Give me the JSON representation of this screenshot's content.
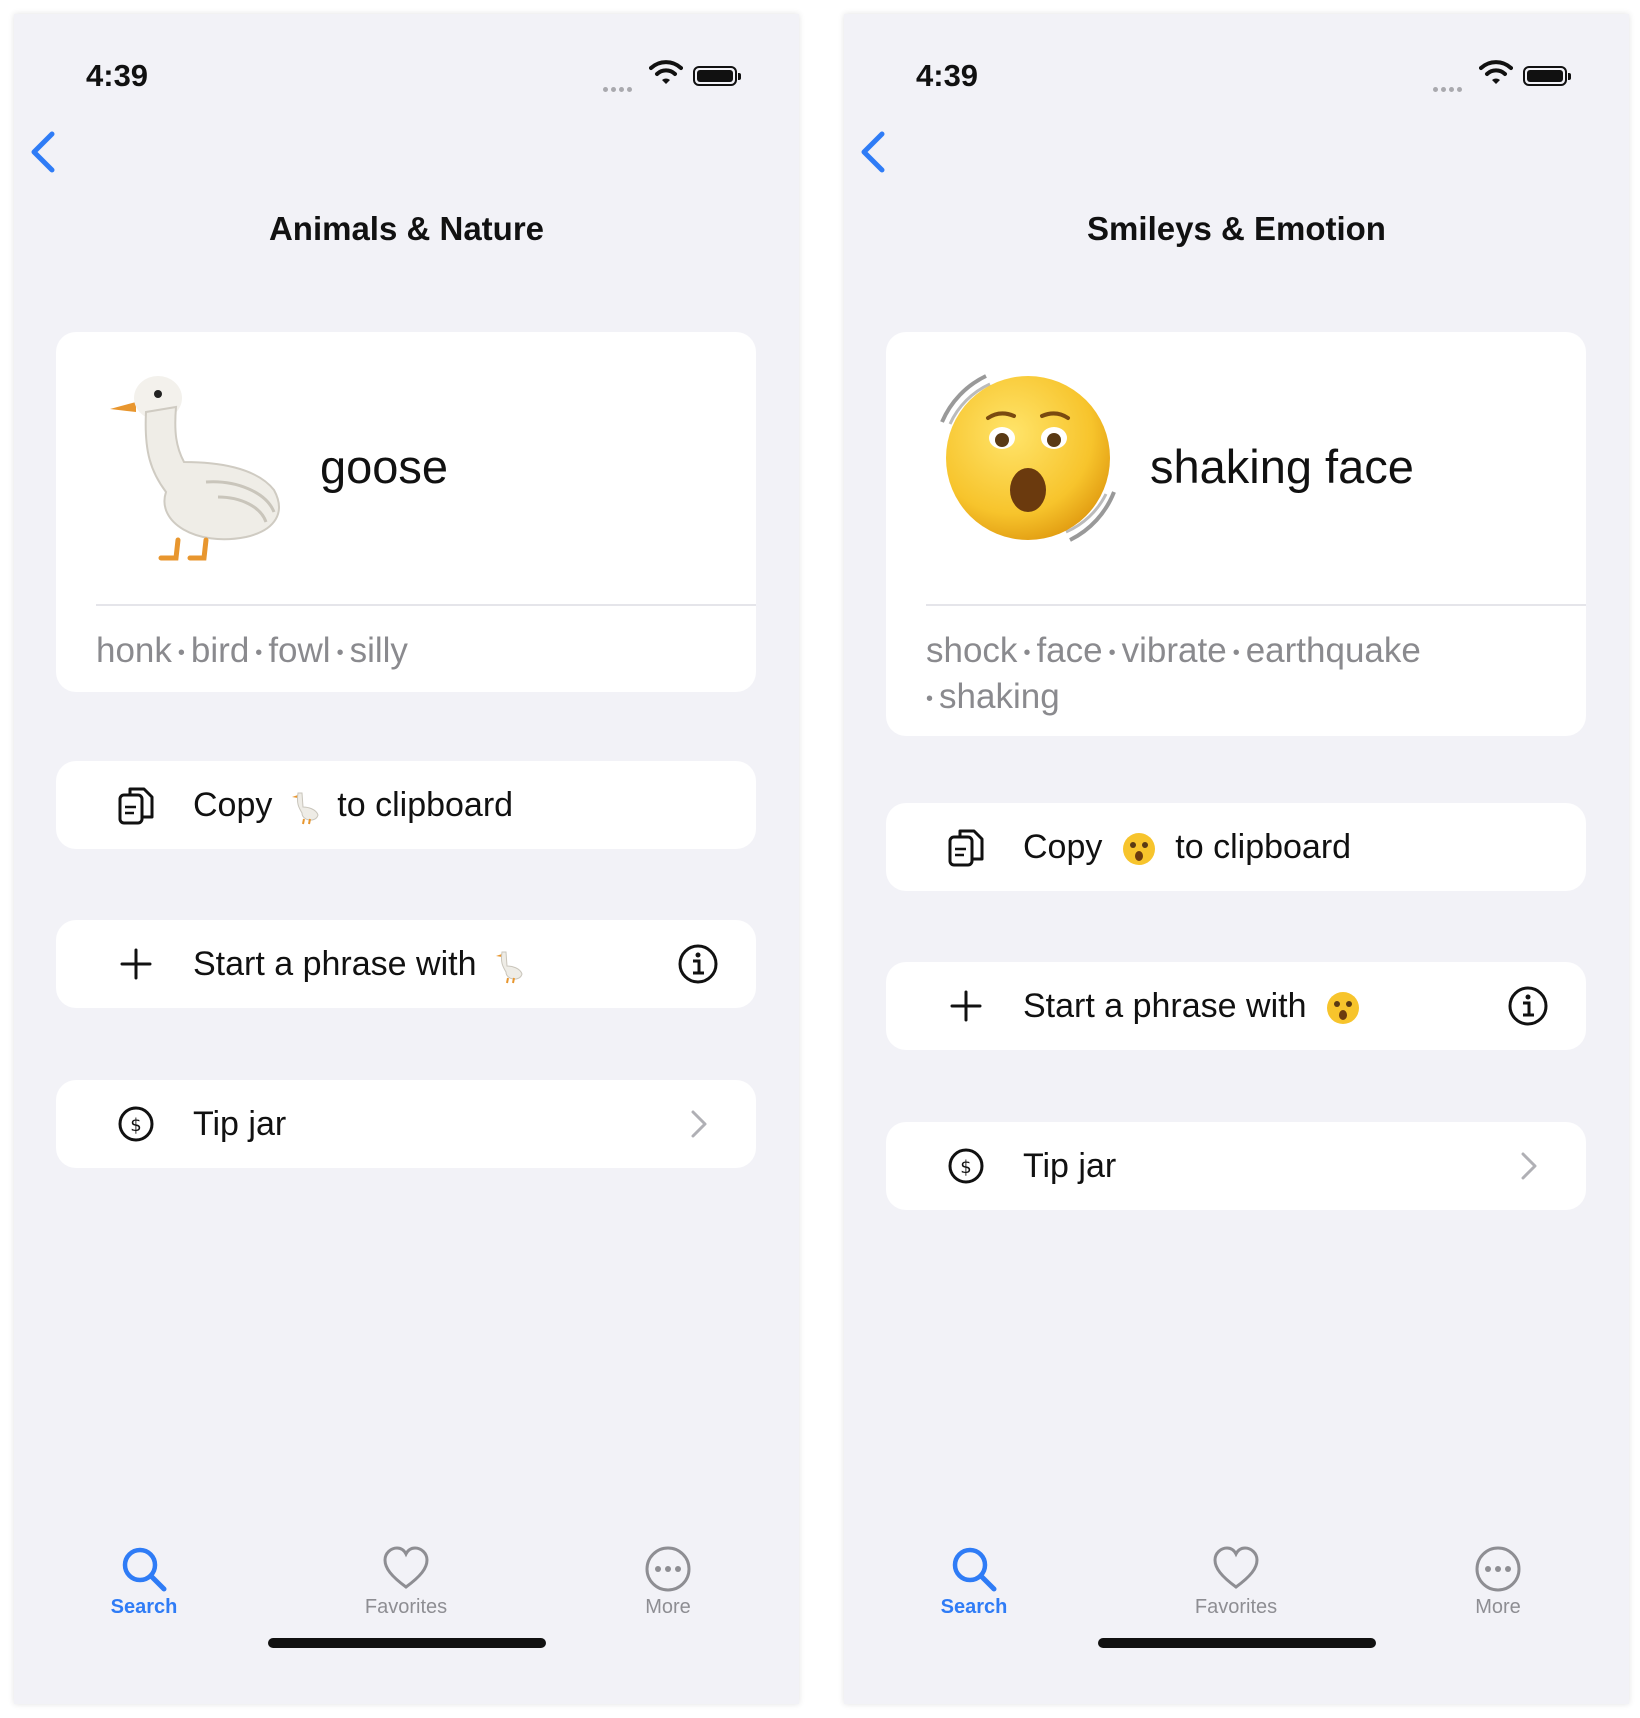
{
  "accent_color": "#2f7cf6",
  "screens": [
    {
      "status_time": "4:39",
      "nav_title": "Animals & Nature",
      "emoji_name": "goose",
      "emoji_char": "🪿",
      "hero_icon": "goose-emoji",
      "tags": [
        "honk",
        "bird",
        "fowl",
        "silly"
      ],
      "copy_label_prefix": "Copy",
      "copy_label_suffix": "to clipboard",
      "phrase_label": "Start a phrase with",
      "tip_label": "Tip jar",
      "tabs": [
        "Search",
        "Favorites",
        "More"
      ]
    },
    {
      "status_time": "4:39",
      "nav_title": "Smileys & Emotion",
      "emoji_name": "shaking face",
      "emoji_char": "🫨",
      "hero_icon": "shaking-face-emoji",
      "tags": [
        "shock",
        "face",
        "vibrate",
        "earthquake",
        "shaking"
      ],
      "copy_label_prefix": "Copy",
      "copy_label_suffix": "to clipboard",
      "phrase_label": "Start a phrase with",
      "tip_label": "Tip jar",
      "tabs": [
        "Search",
        "Favorites",
        "More"
      ]
    }
  ]
}
